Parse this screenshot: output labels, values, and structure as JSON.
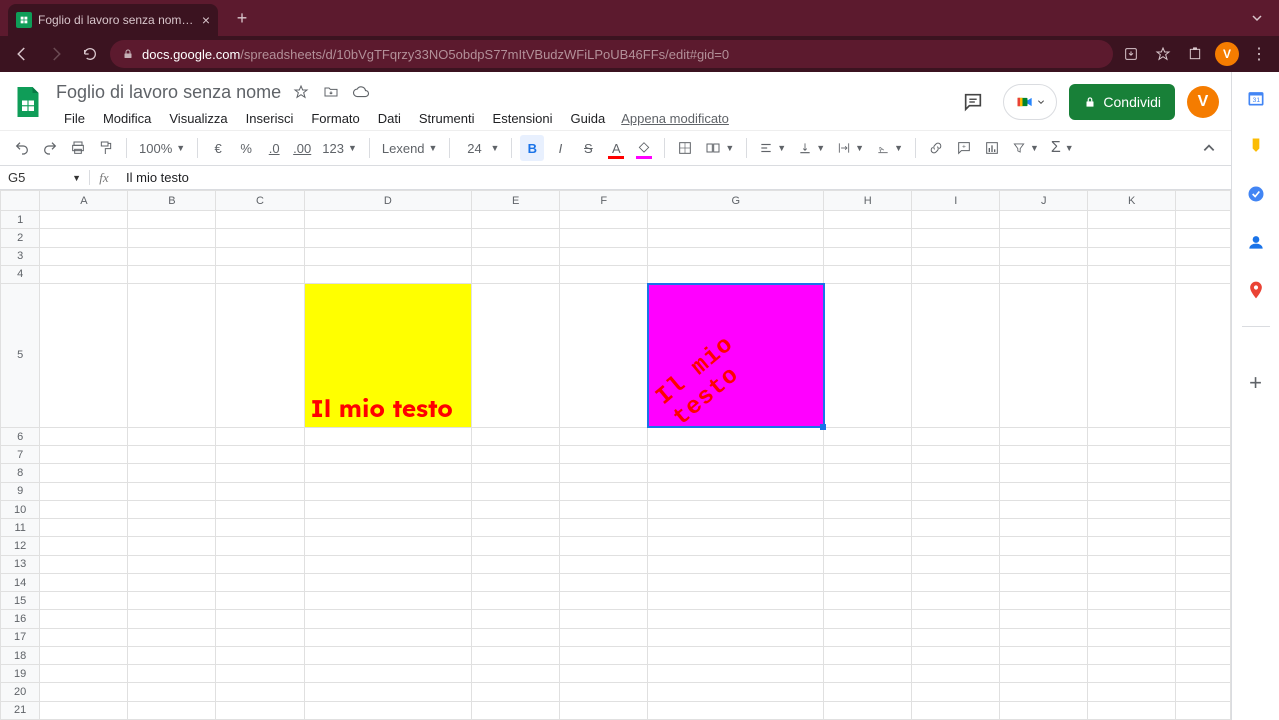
{
  "browser": {
    "tab_title": "Foglio di lavoro senza nome - F",
    "url_host": "docs.google.com",
    "url_path": "/spreadsheets/d/10bVgTFqrzy33NO5obdpS77mItVBudzWFiLPoUB46FFs/edit#gid=0",
    "avatar_initial": "V"
  },
  "header": {
    "doc_title": "Foglio di lavoro senza nome",
    "menus": [
      "File",
      "Modifica",
      "Visualizza",
      "Inserisci",
      "Formato",
      "Dati",
      "Strumenti",
      "Estensioni",
      "Guida"
    ],
    "last_edit": "Appena modificato",
    "share_label": "Condividi",
    "avatar_initial": "V"
  },
  "toolbar": {
    "zoom": "100%",
    "currency": "€",
    "percent": "%",
    "dec_decrease": ".0",
    "dec_increase": ".00",
    "number_format": "123",
    "font_name": "Lexend",
    "font_size": "24",
    "bold": "B",
    "italic": "I",
    "strike": "S",
    "text_color_letter": "A"
  },
  "formula_bar": {
    "name_box": "G5",
    "formula": "Il mio testo"
  },
  "grid": {
    "columns": [
      "A",
      "B",
      "C",
      "D",
      "E",
      "F",
      "G",
      "H",
      "I",
      "J",
      "K",
      ""
    ],
    "rows": 21,
    "tall_row": 5,
    "selected": "G5",
    "cells": {
      "D5": {
        "text": "Il mio testo"
      },
      "G5": {
        "text": "Il mio testo"
      }
    }
  }
}
